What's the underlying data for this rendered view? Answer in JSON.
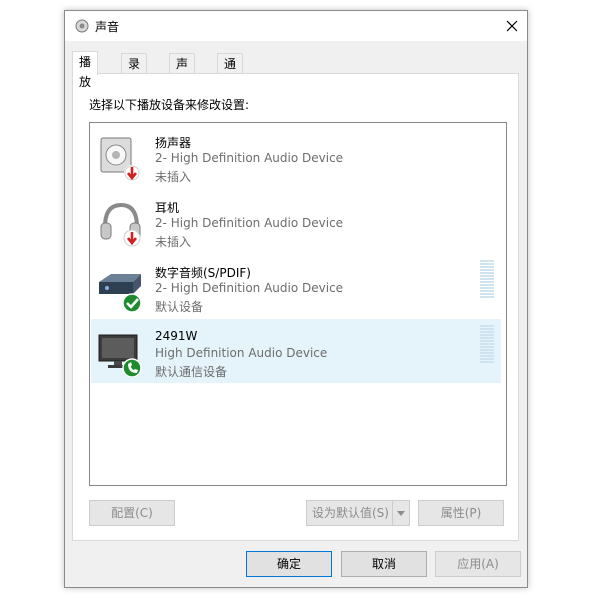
{
  "window": {
    "title": "声音"
  },
  "tabs": [
    {
      "label": "播放",
      "active": true
    },
    {
      "label": "录制",
      "active": false
    },
    {
      "label": "声音",
      "active": false
    },
    {
      "label": "通信",
      "active": false
    }
  ],
  "panel": {
    "instruction": "选择以下播放设备来修改设置:",
    "devices": [
      {
        "name": "扬声器",
        "description": "2- High Definition Audio Device",
        "status": "未插入",
        "badge": "down-arrow-red"
      },
      {
        "name": "耳机",
        "description": "2- High Definition Audio Device",
        "status": "未插入",
        "badge": "down-arrow-red"
      },
      {
        "name": "数字音频(S/PDIF)",
        "description": "2- High Definition Audio Device",
        "status": "默认设备",
        "badge": "check-green"
      },
      {
        "name": "2491W",
        "description": "High Definition Audio Device",
        "status": "默认通信设备",
        "badge": "phone-green"
      }
    ],
    "buttons": {
      "configure": "配置(C)",
      "set_default": "设为默认值(S)",
      "properties": "属性(P)"
    }
  },
  "footer": {
    "ok": "确定",
    "cancel": "取消",
    "apply": "应用(A)"
  },
  "colors": {
    "selection": "#e5f3fb",
    "accent": "#0078d7",
    "disabled_text": "#8c8c8c"
  }
}
